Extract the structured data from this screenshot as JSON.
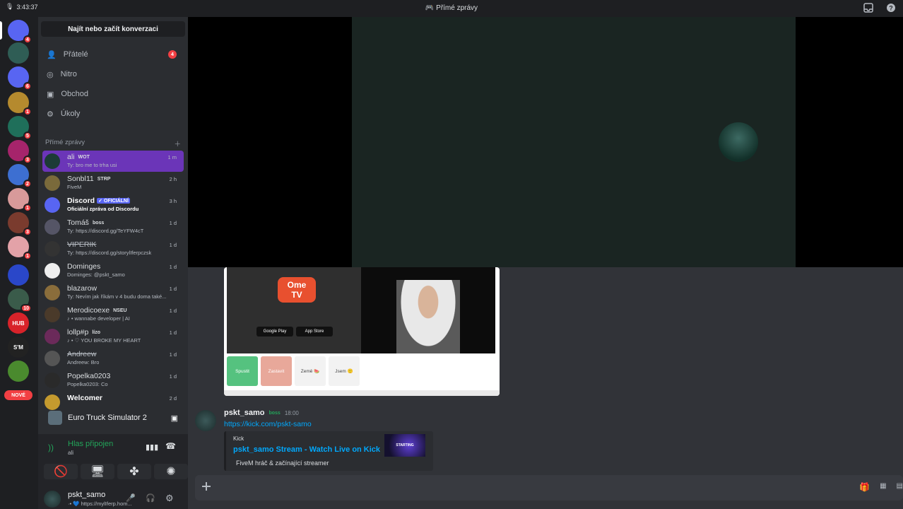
{
  "topbar": {
    "time": "3:43:37",
    "title": "Přímé zprávy"
  },
  "guilds": [
    {
      "badge": "4",
      "color": "#5865f2",
      "icon": "discord-icon"
    },
    {
      "badge": "",
      "color": "#2f5d55",
      "icon": "server-icon"
    },
    {
      "badge": "6",
      "color": "#5865f2",
      "icon": "discord-icon"
    },
    {
      "badge": "1",
      "color": "#b58a2e",
      "icon": "server-icon"
    },
    {
      "badge": "5",
      "color": "#1f6f5a",
      "icon": "server-icon"
    },
    {
      "badge": "3",
      "color": "#a6246b",
      "icon": "server-icon"
    },
    {
      "badge": "2",
      "color": "#3d6fd1",
      "icon": "server-icon"
    },
    {
      "badge": "1",
      "color": "#d89a9a",
      "icon": "server-icon"
    },
    {
      "badge": "3",
      "color": "#7a3b2e",
      "icon": "server-icon"
    },
    {
      "badge": "1",
      "color": "#e3a2a8",
      "icon": "server-icon"
    },
    {
      "badge": "",
      "color": "#2a47c9",
      "icon": "server-icon"
    },
    {
      "badge": "10",
      "color": "#3a5b4a",
      "icon": "server-icon"
    },
    {
      "badge": "",
      "color": "#d8232a",
      "icon": "hub-icon",
      "text": "HUB"
    },
    {
      "badge": "",
      "color": "#222",
      "icon": "server-icon",
      "text": "S'M"
    },
    {
      "badge": "",
      "color": "#4a8a2e",
      "icon": "server-icon"
    }
  ],
  "nove_label": "NOVÉ",
  "sidebar": {
    "search": "Najít nebo začít konverzaci",
    "nav": [
      {
        "label": "Přátelé",
        "badge": "4",
        "icon": "friends-icon"
      },
      {
        "label": "Nitro",
        "badge": "",
        "icon": "nitro-icon"
      },
      {
        "label": "Obchod",
        "badge": "",
        "icon": "shop-icon"
      },
      {
        "label": "Úkoly",
        "badge": "",
        "icon": "quests-icon"
      }
    ],
    "dm_header": "Přímé zprávy",
    "dms": [
      {
        "name": "ali",
        "tag": "WOT",
        "sub": "Ty: bro me to trha usi",
        "when": "1 m",
        "active": true,
        "style": ""
      },
      {
        "name": "Sonbl11",
        "tag": "STRP",
        "sub": "FiveM",
        "when": "2 h",
        "active": false,
        "style": ""
      },
      {
        "name": "Discord",
        "tag": "✓ OFICIÁLNÍ",
        "sub": "Oficiální zpráva od Discordu",
        "when": "3 h",
        "active": false,
        "style": "bold"
      },
      {
        "name": "Tomáš",
        "tag": "boss",
        "sub": "Ty: https://discord.gg/TeYFW4cT",
        "when": "1 d",
        "active": false,
        "style": ""
      },
      {
        "name": "VIPERIK",
        "tag": "",
        "sub": "Ty: https://discord.gg/storylIferpczsk",
        "when": "1 d",
        "active": false,
        "style": "strike"
      },
      {
        "name": "Dominges",
        "tag": "",
        "sub": "Dominges: @pskt_samo",
        "when": "1 d",
        "active": false,
        "style": ""
      },
      {
        "name": "blazarow",
        "tag": "",
        "sub": "Ty: Nevím jak říkám v 4 budu doma také...",
        "when": "1 d",
        "active": false,
        "style": ""
      },
      {
        "name": "Merodicoexe",
        "tag": "NSEU",
        "sub": "♪ • wannabe developer | AI",
        "when": "1 d",
        "active": false,
        "style": ""
      },
      {
        "name": "lollp#p",
        "tag": "lízo",
        "sub": "♪ • ♡ YOU BROKE MY HEART",
        "when": "1 d",
        "active": false,
        "style": ""
      },
      {
        "name": "Andreew",
        "tag": "",
        "sub": "Andreew: Bro",
        "when": "1 d",
        "active": false,
        "style": "strike"
      },
      {
        "name": "Popelka0203",
        "tag": "",
        "sub": "Popelka0203: Co",
        "when": "1 d",
        "active": false,
        "style": ""
      },
      {
        "name": "Welcomer",
        "tag": "",
        "sub": "",
        "when": "2 d",
        "active": false,
        "style": "bold"
      }
    ],
    "game": "Euro Truck Simulator 2",
    "voice_status": "Hlas připojen",
    "voice_where": "ali",
    "user_name": "pskt_samo",
    "user_status": "·• 💙 https://mylIferp.hom..."
  },
  "shot": {
    "logo_top": "Ome",
    "logo_bottom": "TV",
    "google": "Google Play",
    "apple": "App Store",
    "buttons": [
      "Spustit",
      "Zastavit",
      "Země 🍉",
      "Jsem 🙂"
    ]
  },
  "message": {
    "author": "pskt_samo",
    "tag": "boss",
    "time": "18:00",
    "link": "https://kick.com/pskt-samo",
    "embed_provider": "Kick",
    "embed_title": "pskt_samo Stream - Watch Live on Kick",
    "embed_desc": "FiveM hráč & začínající streamer",
    "embed_thumb": "STARTING"
  }
}
